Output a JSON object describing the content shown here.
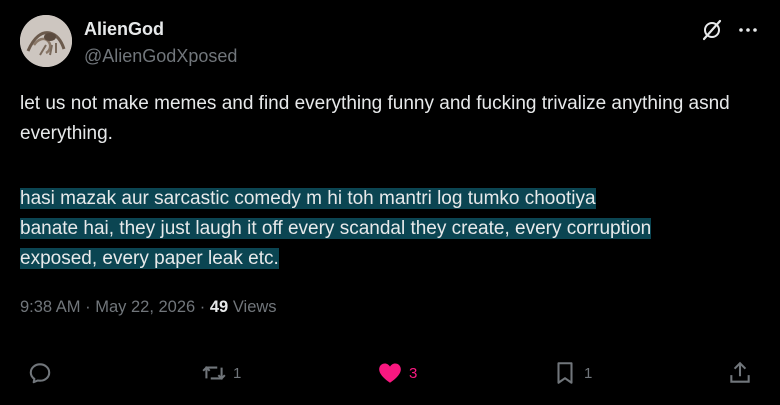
{
  "author": {
    "display_name": "AlienGod",
    "handle": "@AlienGodXposed"
  },
  "post": {
    "paragraph1": "let us not make memes and find everything funny and fucking trivalize anything asnd everything.",
    "paragraph2_lines": [
      "hasi mazak aur sarcastic comedy m hi toh mantri log tumko chootiya",
      "banate hai, they just laugh it off every scandal they create, every corruption",
      "exposed, every paper leak etc."
    ]
  },
  "meta": {
    "time": "9:38 AM",
    "sep1": " · ",
    "date": "May 22, 2026",
    "sep2": " · ",
    "views_count": "49",
    "views_label": " Views"
  },
  "actions": {
    "reply": {
      "icon": "reply-icon"
    },
    "repost": {
      "icon": "repost-icon",
      "count": "1"
    },
    "like": {
      "icon": "heart-icon",
      "count": "3",
      "liked": true,
      "color": "#f91880"
    },
    "bookmark": {
      "icon": "bookmark-icon",
      "count": "1"
    },
    "share": {
      "icon": "share-icon"
    }
  },
  "header_icons": [
    "grok-icon",
    "more-icon"
  ],
  "colors": {
    "background": "#000000",
    "text": "#e7e9ea",
    "muted": "#71767b",
    "highlight": "#0b4552",
    "like": "#f91880"
  }
}
